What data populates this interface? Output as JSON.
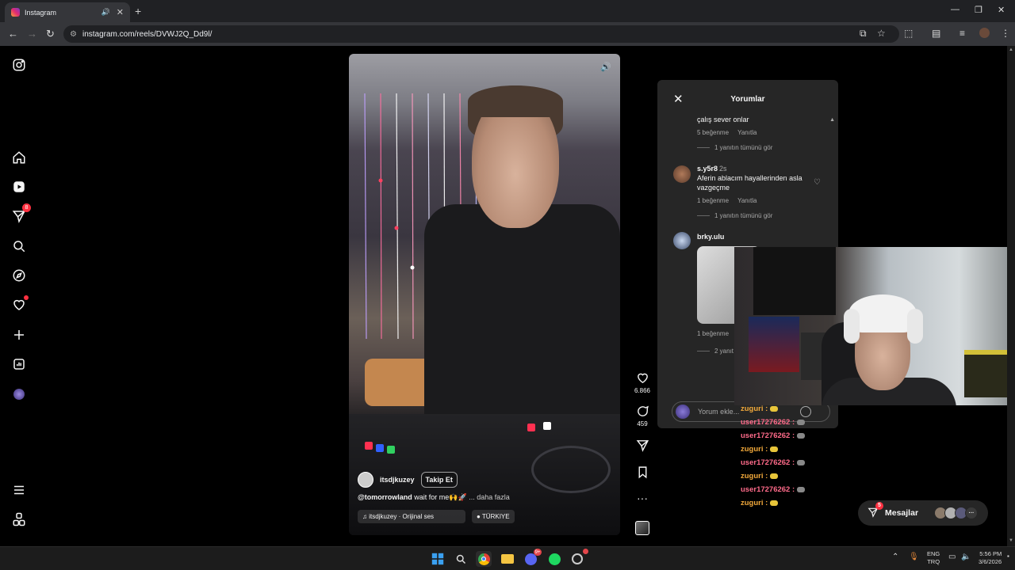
{
  "browser": {
    "tab_title": "Instagram",
    "url": "instagram.com/reels/DVWJ2Q_Dd9l/"
  },
  "sidebar": {
    "notifications_badge": "8"
  },
  "reel": {
    "username": "itsdjkuzey",
    "follow_label": "Takip Et",
    "caption_mention": "@tomorrowland",
    "caption_text": " wait for me🙌🚀",
    "caption_more": "... daha fazla",
    "audio": "itsdjkuzey · Orijinal ses",
    "location": "TÜRKIYE",
    "likes": "6.866",
    "comments_count": "459"
  },
  "comments": {
    "title": "Yorumlar",
    "items": [
      {
        "text": "çalış sever onlar",
        "likes": "5 beğenme",
        "reply": "Yanıtla",
        "view_replies": "1 yanıtın tümünü gör"
      },
      {
        "user": "s.y5r8",
        "time": "2s",
        "text": "Aferin ablacım hayallerinden asla vazgeçme",
        "likes": "1 beğenme",
        "reply": "Yanıtla",
        "view_replies": "1 yanıtın tümünü gör"
      },
      {
        "user": "brky.ulu",
        "likes": "1 beğenme",
        "view_replies": "2 yanıt"
      }
    ],
    "input_placeholder": "Yorum ekle..."
  },
  "chat": [
    {
      "name": "zuguri :",
      "color": "#f2a93b",
      "emote": "#e8c53a"
    },
    {
      "name": "user17276262 :",
      "color": "#ff6b8a",
      "emote": "#888888"
    },
    {
      "name": "user17276262 :",
      "color": "#ff6b8a",
      "emote": "#888888"
    },
    {
      "name": "zuguri :",
      "color": "#f2a93b",
      "emote": "#e8c53a"
    },
    {
      "name": "user17276262 :",
      "color": "#ff6b8a",
      "emote": "#888888"
    },
    {
      "name": "zuguri :",
      "color": "#f2a93b",
      "emote": "#e8c53a"
    },
    {
      "name": "user17276262 :",
      "color": "#ff6b8a",
      "emote": "#888888"
    },
    {
      "name": "zuguri :",
      "color": "#f2a93b",
      "emote": "#e8c53a"
    }
  ],
  "messages": {
    "label": "Mesajlar",
    "badge": "5"
  },
  "taskbar": {
    "discord_badge": "9+",
    "lang_line1": "ENG",
    "lang_line2": "TRQ",
    "time": "5:56 PM",
    "date": "3/6/2026"
  },
  "colors": {
    "accent_red": "#ff3040",
    "panel_bg": "#262626"
  }
}
